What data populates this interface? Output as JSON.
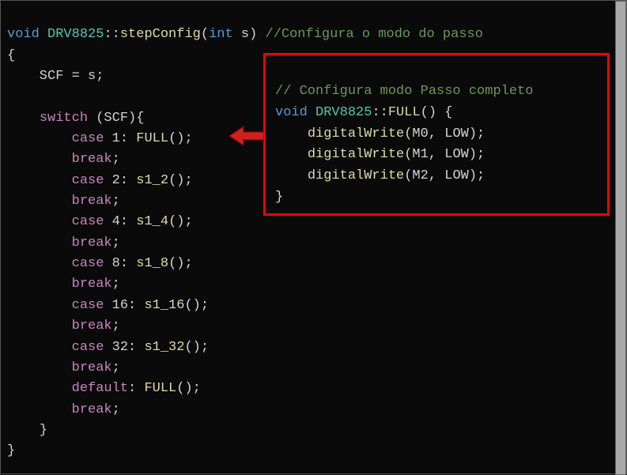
{
  "main_code": {
    "signature": {
      "void": "void",
      "class": "DRV8825",
      "scope": "::",
      "func": "stepConfig",
      "open_paren": "(",
      "param_type": "int",
      "param_name": " s",
      "close_paren": ")",
      "comment": " //Configura o modo do passo"
    },
    "open_brace": "{",
    "assign": "    SCF = s;",
    "blank": "",
    "switch": {
      "kw": "switch",
      "expr": " (SCF){"
    },
    "cases": [
      {
        "kw": "case",
        "label": " 1: ",
        "call": "FULL",
        "tail": "();"
      },
      {
        "kw": "break",
        "tail": ";"
      },
      {
        "kw": "case",
        "label": " 2: ",
        "call": "s1_2",
        "tail": "();"
      },
      {
        "kw": "break",
        "tail": ";"
      },
      {
        "kw": "case",
        "label": " 4: ",
        "call": "s1_4",
        "tail": "();"
      },
      {
        "kw": "break",
        "tail": ";"
      },
      {
        "kw": "case",
        "label": " 8: ",
        "call": "s1_8",
        "tail": "();"
      },
      {
        "kw": "break",
        "tail": ";"
      },
      {
        "kw": "case",
        "label": " 16: ",
        "call": "s1_16",
        "tail": "();"
      },
      {
        "kw": "break",
        "tail": ";"
      },
      {
        "kw": "case",
        "label": " 32: ",
        "call": "s1_32",
        "tail": "();"
      },
      {
        "kw": "break",
        "tail": ";"
      },
      {
        "kw": "default",
        "label": ": ",
        "call": "FULL",
        "tail": "();"
      },
      {
        "kw": "break",
        "tail": ";"
      }
    ],
    "close_switch": "    }",
    "close_brace": "}"
  },
  "callout_code": {
    "comment": "// Configura modo Passo completo",
    "signature": {
      "void": "void",
      "class": "DRV8825",
      "scope": "::",
      "func": "FULL",
      "parens": "() {"
    },
    "body": [
      {
        "func": "digitalWrite",
        "args": "(M0, LOW);"
      },
      {
        "func": "digitalWrite",
        "args": "(M1, LOW);"
      },
      {
        "func": "digitalWrite",
        "args": "(M2, LOW);"
      }
    ],
    "close_brace": "}"
  },
  "arrow": {
    "fill": "#cc2222"
  }
}
